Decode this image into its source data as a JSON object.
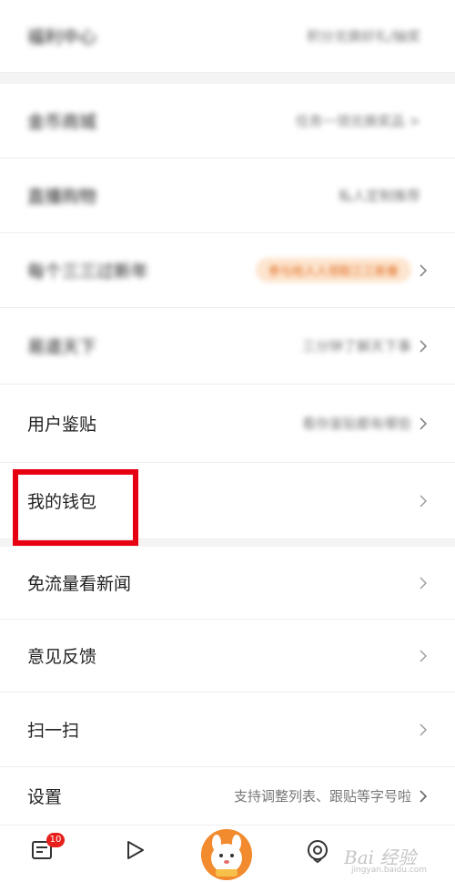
{
  "menu": {
    "top_item": {
      "label": "福利中心",
      "sub": "积分兑换好礼/抽奖"
    },
    "blurred_items": [
      {
        "label": "金币商城",
        "sub": "任务一领兑换奖品 >"
      },
      {
        "label": "直播购物",
        "sub": "私人定制推荐"
      },
      {
        "label": "每个三三过新年",
        "sub": "参与抢人人领取三三新春"
      },
      {
        "label": "易道天下",
        "sub": "三分钟了解天下事"
      }
    ],
    "items": [
      {
        "label": "用户鉴贴",
        "sub": ""
      },
      {
        "label": "我的钱包",
        "sub": ""
      },
      {
        "label": "免流量看新闻",
        "sub": ""
      },
      {
        "label": "意见反馈",
        "sub": ""
      },
      {
        "label": "扫一扫",
        "sub": ""
      },
      {
        "label": "设置",
        "sub": "支持调整列表、跟贴等字号啦"
      }
    ]
  },
  "tabbar": {
    "news_badge": "10",
    "watermark": "Bai 经验",
    "watermark_sub": "jingyan.baidu.com"
  },
  "colors": {
    "highlight": "#e60012",
    "badge": "#e8201c",
    "accent_pill": "#fde5cf"
  },
  "icons": [
    "news-icon",
    "play-icon",
    "mascot-avatar",
    "location-icon",
    "chevron-right-icon"
  ]
}
